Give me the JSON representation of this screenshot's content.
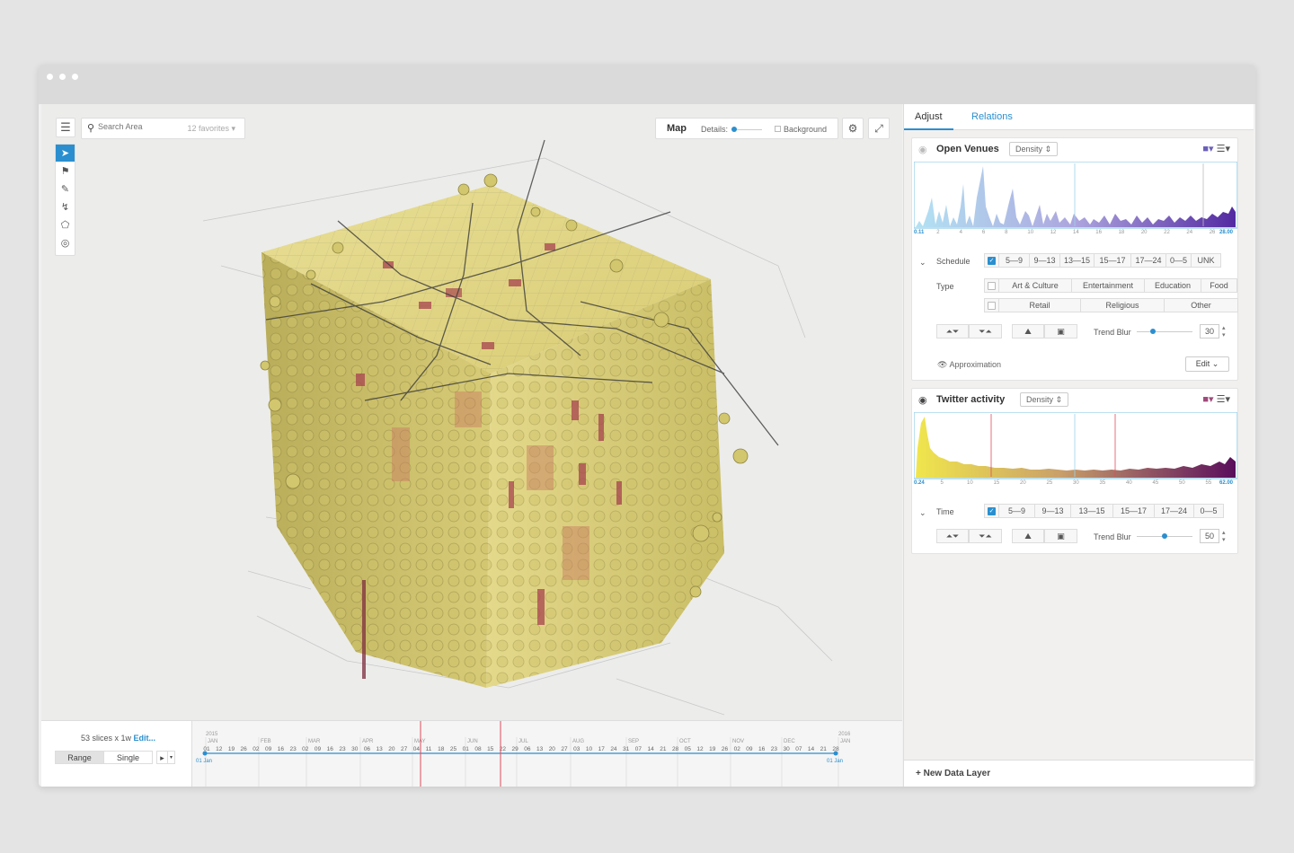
{
  "viewport": {
    "menu_icon": "hamburger-icon",
    "search": {
      "placeholder": "Search Area",
      "favorites": "12 favorites"
    },
    "tools": [
      "cursor-icon",
      "flag-icon",
      "brush-icon",
      "path-icon",
      "polygon-icon",
      "compass-icon"
    ],
    "mapbar": {
      "map_label": "Map",
      "details_label": "Details:",
      "background_label": "Background"
    },
    "buttons": [
      "globe-settings-icon",
      "expand-icon"
    ]
  },
  "timeline": {
    "slices_text": "53 slices x 1w",
    "edit_link": "Edit...",
    "range_label": "Range",
    "single_label": "Single",
    "start_year": "2015",
    "end_year": "2016",
    "start_caption": "01 Jan",
    "end_caption": "01 Jan",
    "months": [
      "JAN",
      "FEB",
      "MAR",
      "APR",
      "MAY",
      "JUN",
      "JUL",
      "AUG",
      "SEP",
      "OCT",
      "NOV",
      "DEC",
      "JAN"
    ],
    "days": [
      "01",
      "12",
      "19",
      "26",
      "02",
      "09",
      "16",
      "23",
      "02",
      "09",
      "16",
      "23",
      "30",
      "06",
      "13",
      "20",
      "27",
      "04",
      "11",
      "18",
      "25",
      "01",
      "08",
      "15",
      "22",
      "29",
      "06",
      "13",
      "20",
      "27",
      "03",
      "10",
      "17",
      "24",
      "31",
      "07",
      "14",
      "21",
      "28",
      "05",
      "12",
      "19",
      "26",
      "02",
      "09",
      "16",
      "23",
      "30",
      "07",
      "14",
      "21",
      "28"
    ]
  },
  "panel": {
    "tabs": {
      "adjust": "Adjust",
      "relations": "Relations"
    },
    "layer1": {
      "title": "Open Venues",
      "mode": "Density",
      "axis_labels": [
        "0.11",
        "2",
        "4",
        "6",
        "8",
        "10",
        "12",
        "14",
        "16",
        "18",
        "20",
        "22",
        "24",
        "26",
        "28.00"
      ],
      "schedule_label": "Schedule",
      "schedule_options": [
        "5—9",
        "9—13",
        "13—15",
        "15—17",
        "17—24",
        "0—5",
        "UNK"
      ],
      "type_label": "Type",
      "type_row1": [
        "Art & Culture",
        "Entertainment",
        "Education",
        "Food"
      ],
      "type_row2": [
        "Retail",
        "Religious",
        "Other"
      ],
      "trend_blur_label": "Trend Blur",
      "trend_blur_value": "30",
      "approximation_label": "Approximation",
      "edit_label": "Edit"
    },
    "layer2": {
      "title": "Twitter activity",
      "mode": "Density",
      "axis_labels": [
        "0.24",
        "5",
        "10",
        "15",
        "20",
        "25",
        "30",
        "35",
        "40",
        "45",
        "50",
        "55",
        "62.00"
      ],
      "time_label": "Time",
      "time_options": [
        "5—9",
        "9—13",
        "13—15",
        "15—17",
        "17—24",
        "0—5"
      ],
      "trend_blur_label": "Trend Blur",
      "trend_blur_value": "50"
    },
    "new_layer_label": "+ New Data Layer"
  }
}
